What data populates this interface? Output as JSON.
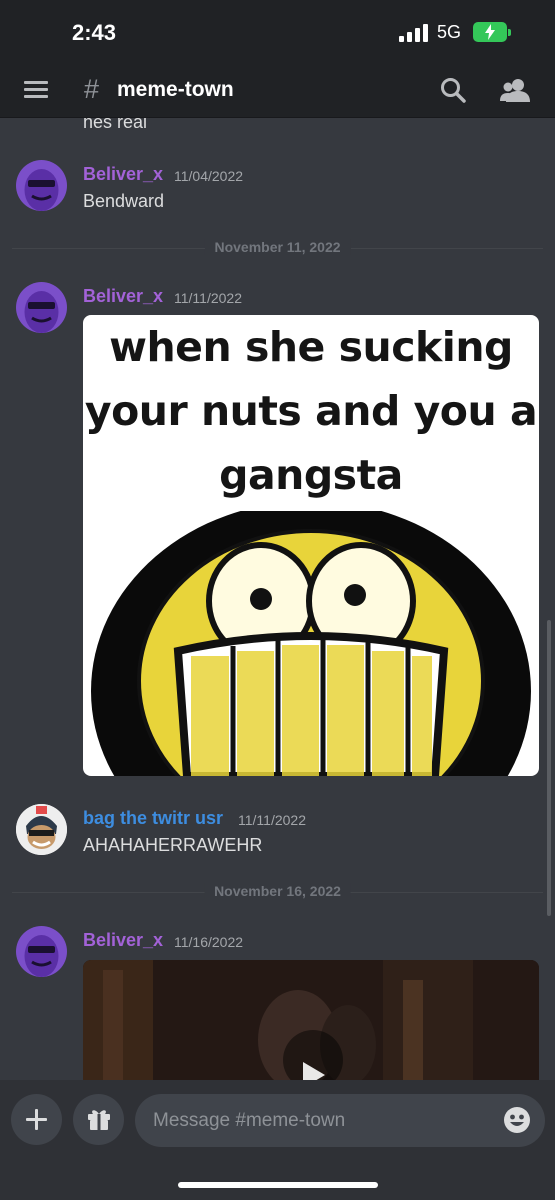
{
  "status_bar": {
    "time": "2:43",
    "network": "5G"
  },
  "header": {
    "channel_hash": "#",
    "channel_name": "meme-town"
  },
  "chat": {
    "previous_text": "hes real",
    "messages": [
      {
        "author": "Beliver_x",
        "timestamp": "11/04/2022",
        "text": "Bendward",
        "author_color": "#a362d8"
      },
      {
        "author": "Beliver_x",
        "timestamp": "11/11/2022",
        "image_caption": "when she sucking your nuts and you a gangsta",
        "author_color": "#a362d8"
      },
      {
        "author": "bag the twitr usr",
        "timestamp": "11/11/2022",
        "text": "AHAHAHERRAWEHR",
        "author_color": "#3d8de0"
      },
      {
        "author": "Beliver_x",
        "timestamp": "11/16/2022",
        "attachment": "video",
        "author_color": "#a362d8"
      }
    ],
    "dividers": [
      "November 11, 2022",
      "November 16, 2022"
    ]
  },
  "composer": {
    "placeholder": "Message #meme-town"
  },
  "icons": {
    "menu": "hamburger-icon",
    "search": "search-icon",
    "members": "members-icon",
    "add": "plus-icon",
    "gift": "gift-icon",
    "emoji": "emoji-icon",
    "play": "play-icon"
  },
  "colors": {
    "background": "#36393f",
    "header": "#202225",
    "composer": "#2f3136"
  }
}
